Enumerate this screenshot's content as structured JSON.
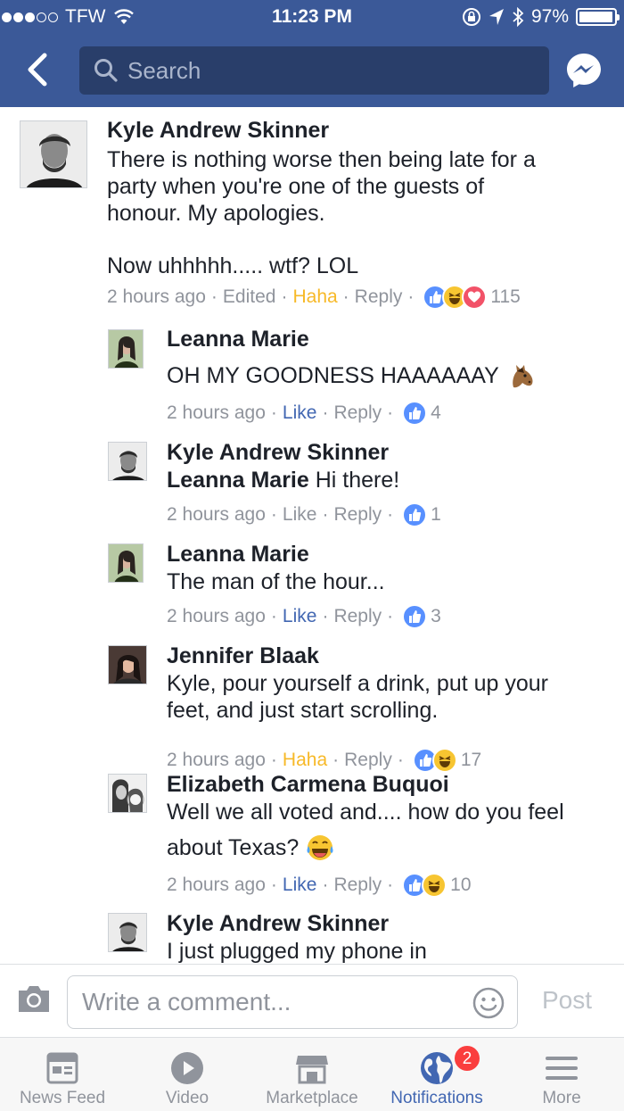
{
  "status_bar": {
    "carrier": "TFW",
    "time": "11:23 PM",
    "battery": "97%",
    "battery_level": 0.97
  },
  "header": {
    "search_placeholder": "Search"
  },
  "comments": [
    {
      "name": "Kyle Andrew Skinner",
      "text_lines": [
        "There is nothing worse then being late for a",
        "party when you're one of the guests of",
        "honour. My apologies."
      ],
      "text_line2": "Now uhhhhh..... wtf? LOL",
      "time": "2 hours ago",
      "edited": "Edited",
      "action": "Haha",
      "reply": "Reply",
      "reactions": [
        "like",
        "haha",
        "love"
      ],
      "count": "115"
    },
    {
      "name": "Leanna Marie",
      "text": "OH MY GOODNESS HAAAAAAY",
      "text_emoji": "horse-face",
      "time": "2 hours ago",
      "action": "Like",
      "reply": "Reply",
      "reactions": [
        "like"
      ],
      "count": "4"
    },
    {
      "name": "Kyle Andrew Skinner",
      "mention": "Leanna Marie",
      "text": "Hi there!",
      "time": "2 hours ago",
      "action": "Like",
      "reply": "Reply",
      "reactions": [
        "like"
      ],
      "count": "1"
    },
    {
      "name": "Leanna Marie",
      "text": "The man of the hour...",
      "time": "2 hours ago",
      "action": "Like",
      "reply": "Reply",
      "reactions": [
        "like"
      ],
      "count": "3"
    },
    {
      "name": "Jennifer Blaak",
      "text_lines": [
        "Kyle, pour yourself a drink, put up your",
        "feet, and just start scrolling."
      ],
      "time": "2 hours ago",
      "action": "Haha",
      "reply": "Reply",
      "reactions": [
        "like",
        "haha"
      ],
      "count": "17"
    },
    {
      "name": "Elizabeth Carmena Buquoi",
      "text_lines": [
        "Well we all voted and.... how do you feel",
        "about Texas?"
      ],
      "text_emoji": "tears-of-joy",
      "time": "2 hours ago",
      "action": "Like",
      "reply": "Reply",
      "reactions": [
        "like",
        "haha"
      ],
      "count": "10"
    },
    {
      "name": "Kyle Andrew Skinner",
      "text": "I just plugged my phone in"
    }
  ],
  "composer": {
    "placeholder": "Write a comment...",
    "post_label": "Post"
  },
  "tabs": [
    {
      "label": "News Feed",
      "icon": "news-feed-icon"
    },
    {
      "label": "Video",
      "icon": "video-icon"
    },
    {
      "label": "Marketplace",
      "icon": "marketplace-icon"
    },
    {
      "label": "Notifications",
      "icon": "globe-icon",
      "badge": "2",
      "active": true
    },
    {
      "label": "More",
      "icon": "menu-icon"
    }
  ],
  "colors": {
    "header": "#3b5998",
    "link": "#4267b2",
    "haha": "#f7b928",
    "meta": "#90949c",
    "badge": "#fa3e3e"
  }
}
